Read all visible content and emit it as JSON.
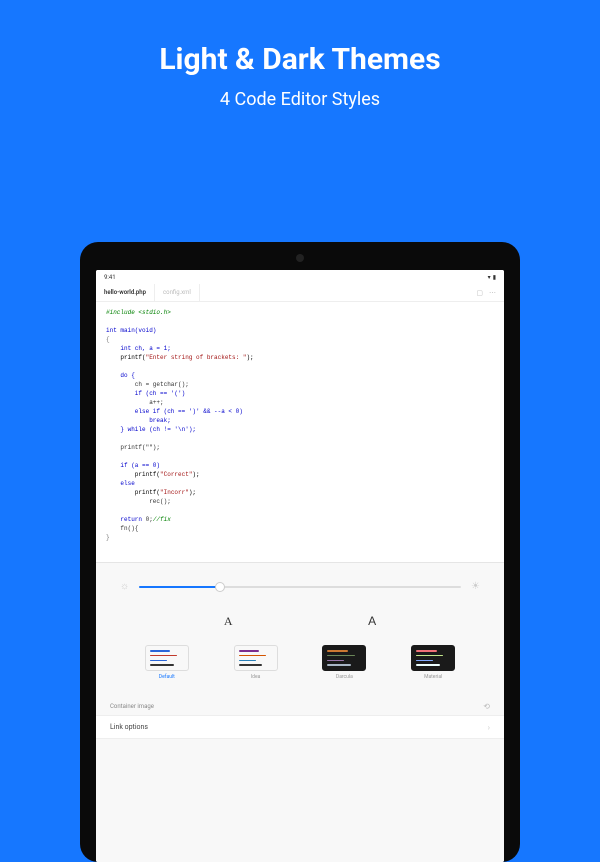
{
  "hero": {
    "title": "Light & Dark Themes",
    "subtitle": "4 Code Editor Styles"
  },
  "statusBar": {
    "time": "9:41"
  },
  "tabs": {
    "active": "hello-world.php",
    "inactive": "config.xml"
  },
  "themes": [
    {
      "label": "Default",
      "active": true,
      "dark": false
    },
    {
      "label": "Idea",
      "active": false,
      "dark": false
    },
    {
      "label": "Darcula",
      "active": false,
      "dark": true
    },
    {
      "label": "Material",
      "active": false,
      "dark": true
    }
  ],
  "fontSamples": {
    "a": "A",
    "b": "A"
  },
  "settings": {
    "sectionTitle": "Container image",
    "linkOption": "Link options"
  },
  "code": {
    "include": "#include <stdio.h>",
    "sig": "int main(void)",
    "decl": "    int ch, a = 1;",
    "printfPrompt": "    printf(\"Enter string of brackets: \");",
    "do": "    do {",
    "getchar": "        ch = getchar();",
    "ifOpen": "        if (ch == '(')",
    "ainc": "            a++;",
    "elseif": "        else if (ch == ')' && --a < 0)",
    "break": "            break;",
    "while": "    } while (ch != '\\n');",
    "printok": "    printf(\"\");",
    "ifa": "    if (a == 0)",
    "printCorrect": "        printf(\"Correct\");",
    "else": "    else",
    "printIncorr": "        printf(\"Incorr\");",
    "rec": "            rec();",
    "retcom": "    return 0;//fix",
    "fn": "    fn(){",
    "end": "}"
  }
}
